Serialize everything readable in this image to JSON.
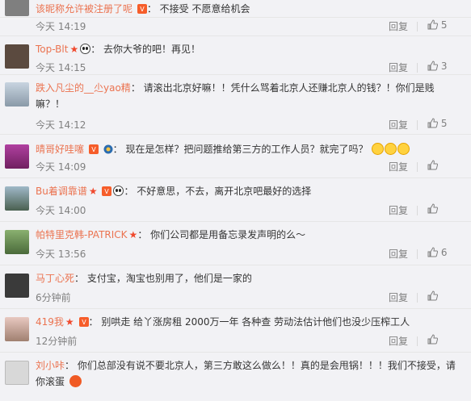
{
  "comments": [
    {
      "user": "该昵称允许被注册了呢",
      "text": "不接受 不愿意给机会",
      "time": "",
      "reply": "",
      "likes": "",
      "colors": {
        "avatar": "#7f7f7f"
      }
    },
    {
      "user": "Top-Blt",
      "text": "去你大爷的吧！再见！",
      "time": "今天 14:19",
      "reply": "回复",
      "likes": "5",
      "colors": {
        "avatar": "#e0e0e0"
      }
    },
    {
      "user": "Top-Blt",
      "text": "去你大爷的吧！再见！",
      "time": "今天 14:15",
      "reply": "回复",
      "likes": "3",
      "colors": {
        "avatar": "#5b4a3f"
      }
    },
    {
      "user": "跌入凡尘的__尐yao精",
      "text": "请滚出北京好嘛！！凭什么骂着北京人还赚北京人的钱？！你们是贱嘛？！",
      "time": "今天 14:12",
      "reply": "回复",
      "likes": "5",
      "colors": {
        "avatar": "#9ab"
      }
    },
    {
      "user": "晴哥好哇噻",
      "text": "现在是怎样？把问题推给第三方的工作人员？就完了吗？",
      "time": "今天 14:09",
      "reply": "回复",
      "likes": "",
      "colors": {
        "avatar": "#a0a"
      }
    },
    {
      "user": "Bu着调靠谱",
      "text": "不好意思，不去，离开北京吧最好的选择",
      "time": "今天 14:00",
      "reply": "回复",
      "likes": "",
      "colors": {
        "avatar": "#6c8a7a"
      }
    },
    {
      "user": "帕特里克韩-PATRICK",
      "text": "你们公司都是用备忘录发声明的么～",
      "time": "今天 13:56",
      "reply": "回复",
      "likes": "6",
      "colors": {
        "avatar": "#6e8d5a"
      }
    },
    {
      "user": "马丁心死",
      "text": "支付宝，淘宝也别用了，他们是一家的",
      "time": "6分钟前",
      "reply": "回复",
      "likes": "",
      "colors": {
        "avatar": "#3a3a3a"
      }
    },
    {
      "user": "419我",
      "text": "别哄走 给丫涨房租 2000万一年 各种查 劳动法估计他们也没少压榨工人",
      "time": "12分钟前",
      "reply": "回复",
      "likes": "",
      "colors": {
        "avatar": "#d6b0a8"
      }
    },
    {
      "user": "刘小咔",
      "text": "你们总部没有说不要北京人，第三方敢这么做么！！真的是会甩锅！！！我们不接受，请你滚蛋",
      "time": "",
      "reply": "",
      "likes": "",
      "colors": {
        "avatar": "#d8d8d8"
      }
    }
  ],
  "accent": "#eb7350"
}
